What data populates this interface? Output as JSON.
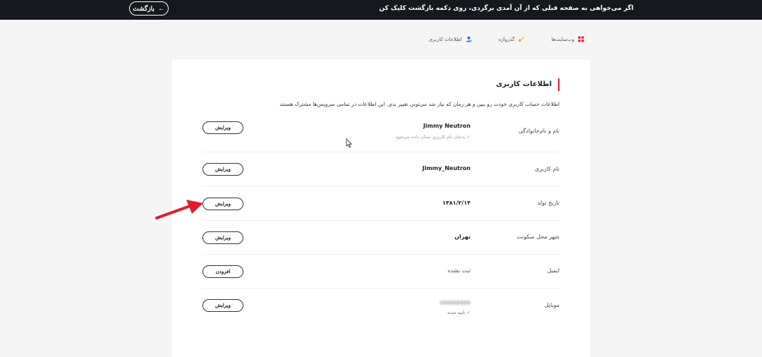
{
  "topbar": {
    "message": "اگر می‌خواهی به صفحه قبلی که از آن آمدی برگردی، روی دکمه بازگشت کلیک کن",
    "back_label": "بازگشت",
    "back_arrow": "←"
  },
  "tabs": [
    {
      "label": "اطلاعات کاربری",
      "icon": "user-icon",
      "color": "#2a6ad8"
    },
    {
      "label": "گذرواژه",
      "icon": "key-icon",
      "color": "#f5a623"
    },
    {
      "label": "وب‌سایت‌ها",
      "icon": "grid-icon",
      "color": "#e01b2e"
    }
  ],
  "section": {
    "title": "اطلاعات کاربری",
    "description": "اطلاعات حساب کاربری خودت رو ببین و هر زمان که نیاز شد می‌تونی تغییر بدی. این اطلاعات در تمامی سرویس‌ها مشترک هستند"
  },
  "rows": [
    {
      "label": "نام و نام‌خانوادگی",
      "value": "Jimmy Neutron",
      "note": "✓ به‌جای نام کاربری نشان داده می‌شود",
      "button": "ویرایش"
    },
    {
      "label": "نام کاربری",
      "value": "Jimmy_Neutron",
      "button": "ویرایش"
    },
    {
      "label": "تاریخ تولد",
      "value": "۱۳۸۱/۲/۱۴",
      "button": "ویرایش"
    },
    {
      "label": "شهر محل سکونت",
      "value": "تهران",
      "button": "ویرایش"
    },
    {
      "label": "ایمیل",
      "value": "ثبت نشده",
      "button": "افزودن"
    },
    {
      "label": "موبایل",
      "note": "✓ تایید شده",
      "button": "ویرایش"
    }
  ],
  "colors": {
    "topbar_bg": "#17181d",
    "accent_red": "#e01b2e",
    "verified_green": "#2aa84a",
    "annotation_arrow": "#e01b2e"
  }
}
